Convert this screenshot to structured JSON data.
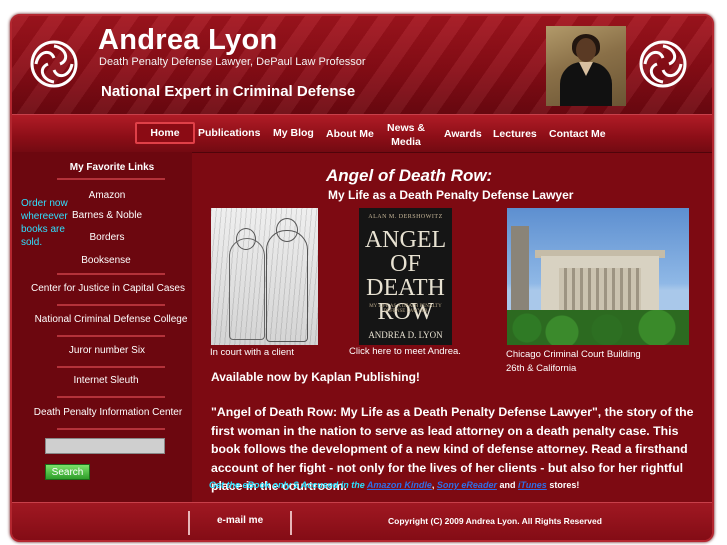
{
  "header": {
    "title": "Andrea Lyon",
    "tagline": "Death Penalty Defense Lawyer, DePaul Law Professor",
    "slogan": "National Expert in Criminal Defense"
  },
  "nav": {
    "home": "Home",
    "publications": "Publications",
    "blog": "My Blog",
    "about": "About Me",
    "news": "News &\nMedia",
    "awards": "Awards",
    "lectures": "Lectures",
    "contact": "Contact Me"
  },
  "sidebar": {
    "heading": "My Favorite Links",
    "order_note": "Order now whereever books are sold.",
    "book_links": [
      "Amazon",
      "Barnes & Noble",
      "Borders",
      "Booksense"
    ],
    "links": [
      "Center for Justice in Capital Cases",
      "National Criminal Defense College",
      "Juror number Six",
      "Internet Sleuth",
      "Death Penalty Information Center"
    ],
    "search_button": "Search",
    "search_value": ""
  },
  "main": {
    "book_title": "Angel of Death Row:",
    "book_subtitle": "My Life as a Death Penalty Defense Lawyer",
    "captions": {
      "court": "In court with a client",
      "book": "Click here to meet Andrea.",
      "building_line1": "Chicago Criminal Court Building",
      "building_line2": "26th & California"
    },
    "book_cover": {
      "top": "ALAN M. DERSHOWITZ",
      "title": "ANGEL OF DEATH ROW",
      "sub": "MY LIFE AS A DEATH PENALTY DEFENSE LAWYER",
      "author": "ANDREA D. LYON"
    },
    "available": "Available now by Kaplan Publishing!",
    "description": "\"Angel of Death Row: My Life as a Death Penalty Defense Lawyer\",  the story of the first woman in the nation to serve as lead attorney on a death penalty case. This book follows the development of a new kind of defense attorney. Read a firsthand account of her fight - not only for the lives of her clients - but also for her rightful place in the courtroom.",
    "ebook": {
      "prefix": "Get the eBook only $",
      "middle": " Accused in the ",
      "link1": "Amazon Kindle",
      "link2": "Sony eReader",
      "and": " and ",
      "link3": "iTunes",
      "suffix": " stores!",
      "sep": ", "
    }
  },
  "footer": {
    "email": "e-mail me",
    "copyright": "Copyright (C) 2009 Andrea Lyon. All Rights Reserved"
  },
  "colors": {
    "background": "#7d0a12",
    "sidebar": "#6c070f",
    "accent_cyan": "#2fe0ff",
    "search_button": "#3fbf35"
  }
}
